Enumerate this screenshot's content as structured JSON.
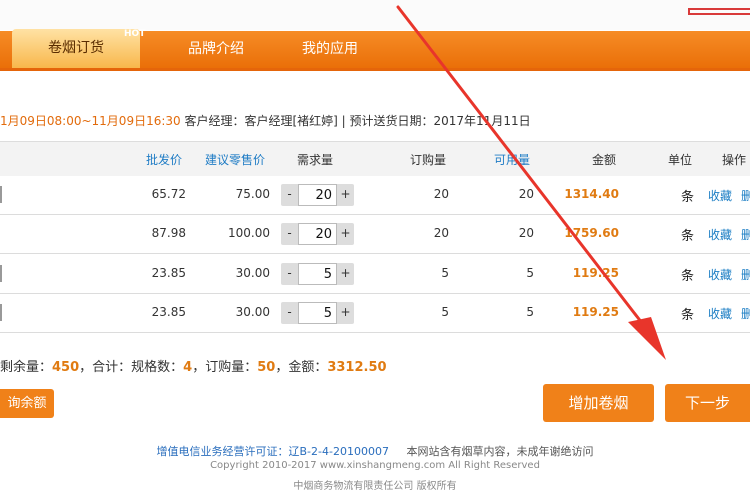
{
  "nav": {
    "tabs": [
      {
        "label": "卷烟订货",
        "badge": "HOT"
      },
      {
        "label": "品牌介绍"
      },
      {
        "label": "我的应用"
      }
    ]
  },
  "info": {
    "time_range": "1月09日08:00~11月09日16:30",
    "rest": " 客户经理：客户经理[褚红婷] | 预计送货日期：2017年11月11日"
  },
  "table": {
    "headers": [
      "批发价",
      "建议零售价",
      "需求量",
      "订购量",
      "可用量",
      "金额",
      "单位",
      "操作"
    ],
    "rows": [
      {
        "price": "65.72",
        "retail": "75.00",
        "demand": "20",
        "ordered": "20",
        "available": "20",
        "amount": "1314.40",
        "unit": "条",
        "fav": "收藏",
        "del": "删"
      },
      {
        "price": "87.98",
        "retail": "100.00",
        "demand": "20",
        "ordered": "20",
        "available": "20",
        "amount": "1759.60",
        "unit": "条",
        "fav": "收藏",
        "del": "删"
      },
      {
        "price": "23.85",
        "retail": "30.00",
        "demand": "5",
        "ordered": "5",
        "available": "5",
        "amount": "119.25",
        "unit": "条",
        "fav": "收藏",
        "del": "删"
      },
      {
        "price": "23.85",
        "retail": "30.00",
        "demand": "5",
        "ordered": "5",
        "available": "5",
        "amount": "119.25",
        "unit": "条",
        "fav": "收藏",
        "del": "删"
      }
    ],
    "minus": "-",
    "plus": "+"
  },
  "summary": {
    "remain_label": "剩余量：",
    "remain": "450",
    "total_label": "，合计：规格数：",
    "specs": "4",
    "ordered_label": "，订购量：",
    "ordered": "50",
    "amount_label": "，金额：",
    "amount": "3312.50"
  },
  "buttons": {
    "balance": "询余额",
    "add": "增加卷烟",
    "next": "下一步"
  },
  "footer": {
    "license_label": "增值电信业务经营许可证：辽B-2-4-20100007",
    "notice": "本网站含有烟草内容，未成年谢绝访问",
    "copyright": "Copyright 2010-2017 www.xinshangmeng.com All Right Reserved",
    "company": "中烟商务物流有限责任公司 版权所有"
  },
  "colors": {
    "accent": "#f07d14",
    "link": "#1f7cc5",
    "money": "#e07b12",
    "arrow": "#e8352b"
  }
}
